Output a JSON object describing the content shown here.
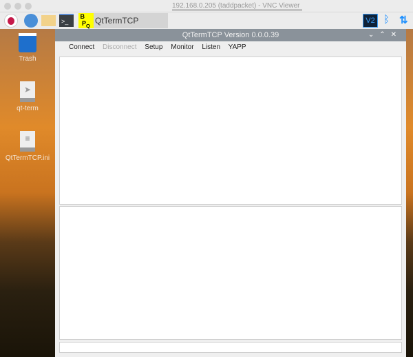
{
  "vnc_title": "192.168.0.205 (taddpacket) - VNC Viewer",
  "taskbar": {
    "task_label": "QtTermTCP Version 0...",
    "task_badge": "BPQ"
  },
  "desktop_icons": [
    {
      "label": "Trash",
      "icon": "trash-icon"
    },
    {
      "label": "qt-term",
      "icon": "executable-icon"
    },
    {
      "label": "QtTermTCP.ini",
      "icon": "text-file-icon"
    }
  ],
  "window": {
    "title": "QtTermTCP Version 0.0.0.39",
    "menu": [
      {
        "label": "Connect",
        "enabled": true
      },
      {
        "label": "Disconnect",
        "enabled": false
      },
      {
        "label": "Setup",
        "enabled": true
      },
      {
        "label": "Monitor",
        "enabled": true
      },
      {
        "label": "Listen",
        "enabled": true
      },
      {
        "label": "YAPP",
        "enabled": true
      }
    ],
    "input_value": ""
  }
}
